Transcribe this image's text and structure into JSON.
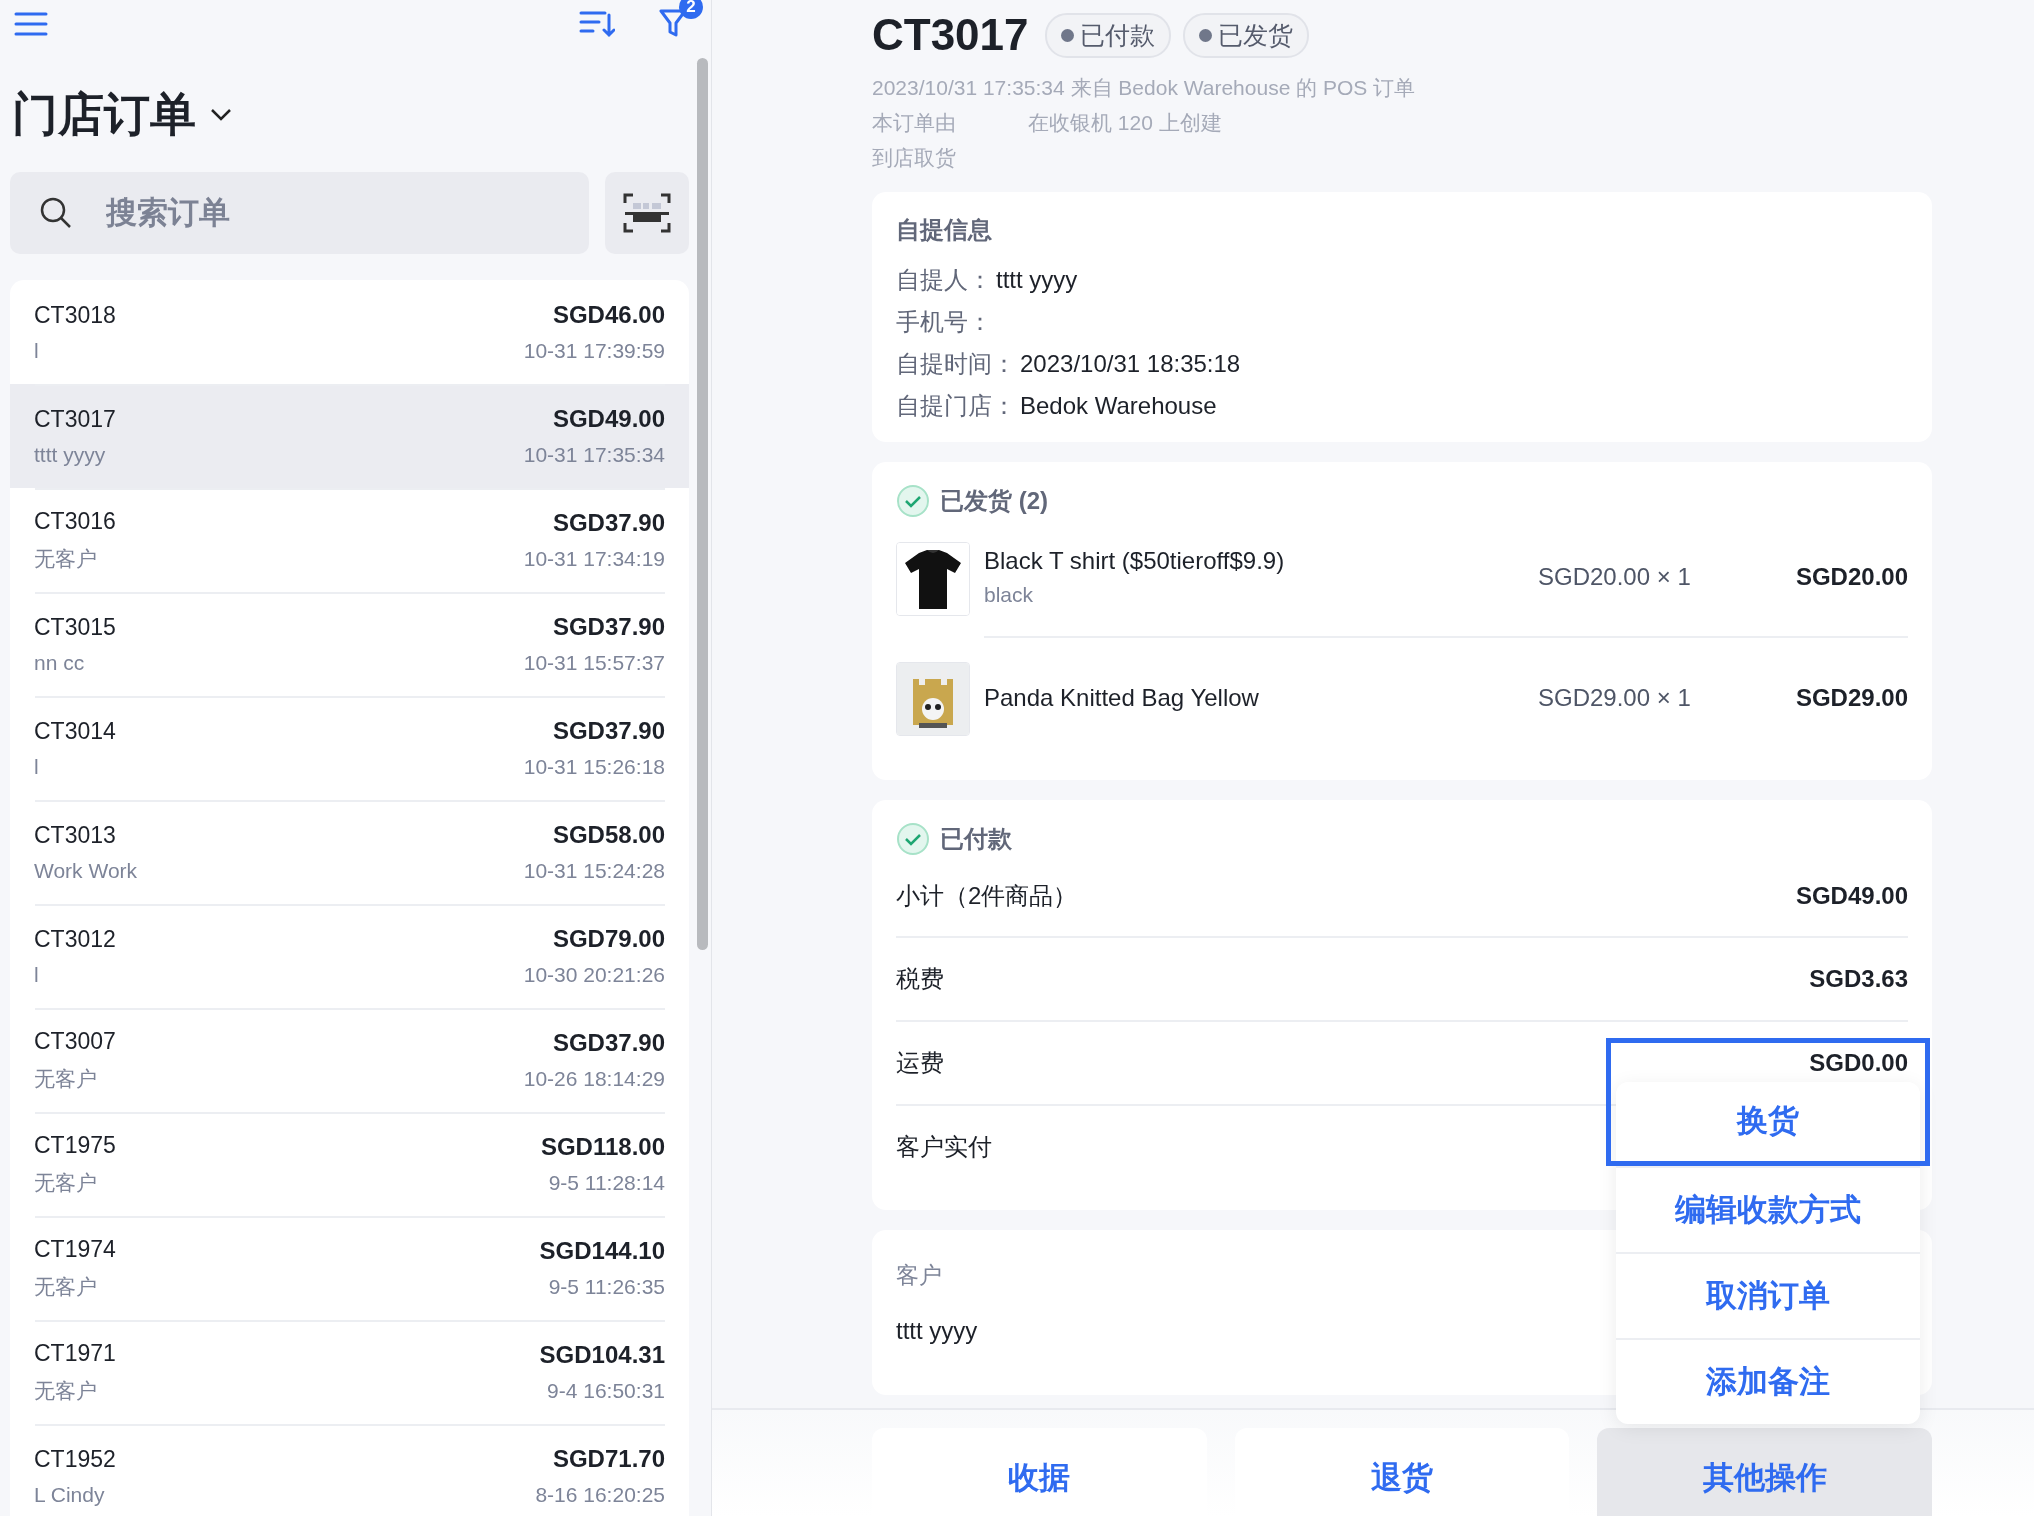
{
  "sidebar": {
    "filter_badge": "2",
    "title": "门店订单",
    "search": {
      "placeholder": "搜索订单"
    },
    "orders": [
      {
        "id": "CT3018",
        "amount": "SGD46.00",
        "customer": "l",
        "time": "10-31 17:39:59",
        "selected": false
      },
      {
        "id": "CT3017",
        "amount": "SGD49.00",
        "customer": "tttt yyyy",
        "time": "10-31 17:35:34",
        "selected": true
      },
      {
        "id": "CT3016",
        "amount": "SGD37.90",
        "customer": "无客户",
        "time": "10-31 17:34:19",
        "selected": false
      },
      {
        "id": "CT3015",
        "amount": "SGD37.90",
        "customer": "nn cc",
        "time": "10-31 15:57:37",
        "selected": false
      },
      {
        "id": "CT3014",
        "amount": "SGD37.90",
        "customer": "l",
        "time": "10-31 15:26:18",
        "selected": false
      },
      {
        "id": "CT3013",
        "amount": "SGD58.00",
        "customer": "Work Work",
        "time": "10-31 15:24:28",
        "selected": false
      },
      {
        "id": "CT3012",
        "amount": "SGD79.00",
        "customer": "l",
        "time": "10-30 20:21:26",
        "selected": false
      },
      {
        "id": "CT3007",
        "amount": "SGD37.90",
        "customer": "无客户",
        "time": "10-26 18:14:29",
        "selected": false
      },
      {
        "id": "CT1975",
        "amount": "SGD118.00",
        "customer": "无客户",
        "time": "9-5 11:28:14",
        "selected": false
      },
      {
        "id": "CT1974",
        "amount": "SGD144.10",
        "customer": "无客户",
        "time": "9-5 11:26:35",
        "selected": false
      },
      {
        "id": "CT1971",
        "amount": "SGD104.31",
        "customer": "无客户",
        "time": "9-4 16:50:31",
        "selected": false
      },
      {
        "id": "CT1952",
        "amount": "SGD71.70",
        "customer": "L Cindy",
        "time": "8-16 16:20:25",
        "selected": false
      }
    ]
  },
  "order": {
    "title": "CT3017",
    "badges": [
      "已付款",
      "已发货"
    ],
    "meta": [
      "2023/10/31 17:35:34 来自 Bedok Warehouse 的 POS 订单"
    ],
    "created": {
      "prefix": "本订单由",
      "suffix": "在收银机 120 上创建"
    },
    "delivery": "到店取货",
    "pickup": {
      "title": "自提信息",
      "rows": [
        {
          "label": "自提人：",
          "value": "tttt yyyy"
        },
        {
          "label": "手机号："
        },
        {
          "label": "自提时间：",
          "value": "2023/10/31 18:35:18"
        },
        {
          "label": "自提门店：",
          "value": "Bedok Warehouse"
        }
      ]
    },
    "fulfillment": {
      "title": "已发货 (2)",
      "items": [
        {
          "name": "Black T shirt ($50tieroff$9.9)",
          "variant": "black",
          "price": "SGD20.00 × 1",
          "total": "SGD20.00",
          "kind": "picture"
        },
        {
          "name": "Panda Knitted Bag Yellow",
          "price": "SGD29.00 × 1",
          "total": "SGD29.00",
          "kind": "picture"
        }
      ]
    },
    "payment": {
      "title": "已付款",
      "rows": [
        {
          "label": "小计（2件商品）",
          "value": "SGD49.00"
        },
        {
          "label": "税费",
          "value": "SGD3.63"
        },
        {
          "label": "运费",
          "value": "SGD0.00"
        },
        {
          "label": "客户实付"
        }
      ]
    },
    "customer": {
      "title": "客户",
      "name": "tttt yyyy"
    },
    "actions": [
      {
        "label": "收据",
        "active": false
      },
      {
        "label": "退货",
        "active": false
      },
      {
        "label": "其他操作",
        "active": true
      }
    ],
    "menu": [
      {
        "label": "换货",
        "selected": true
      },
      {
        "label": "编辑收款方式",
        "selected": false
      },
      {
        "label": "取消订单",
        "selected": false
      },
      {
        "label": "添加备注",
        "selected": false
      }
    ]
  }
}
